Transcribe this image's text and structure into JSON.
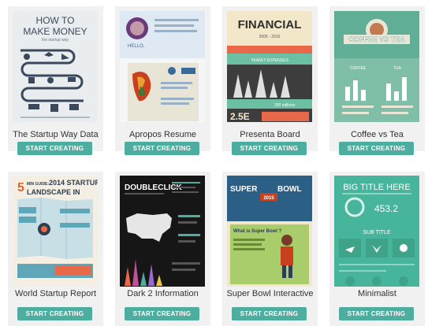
{
  "templates": [
    {
      "title": "The Startup Way Data",
      "button": "START CREATING",
      "thumb_text": [
        "HOW TO",
        "MAKE MONEY",
        "the startup way"
      ]
    },
    {
      "title": "Apropos Resume",
      "button": "START CREATING",
      "thumb_text": [
        "HELLO,"
      ]
    },
    {
      "title": "Presenta Board",
      "button": "START CREATING",
      "thumb_text": [
        "FINANCIAL",
        "2005 - 2015",
        "YEARLY EXPENSES",
        "200 millions",
        "2.5E"
      ]
    },
    {
      "title": "Coffee vs Tea",
      "button": "START CREATING",
      "thumb_text": [
        "COFFEE VS TEA",
        "COFFEE",
        "TEA"
      ]
    },
    {
      "title": "World Startup Report",
      "button": "START CREATING",
      "thumb_text": [
        "5",
        "MIN GUIDE:",
        "2014 STARTUP",
        "LANDSCAPE IN"
      ]
    },
    {
      "title": "Dark 2 Information",
      "button": "START CREATING",
      "thumb_text": [
        "DOUBLECLICK"
      ]
    },
    {
      "title": "Super Bowl Interactive",
      "button": "START CREATING",
      "thumb_text": [
        "SUPER",
        "BOWL",
        "2015",
        "What is Super Bowl ?"
      ]
    },
    {
      "title": "Minimalist",
      "button": "START CREATING",
      "thumb_text": [
        "BIG TITLE HERE",
        "453.2",
        "SUB TITLE"
      ]
    }
  ],
  "colors": {
    "button": "#4dae9f",
    "card_bg": "#f1f1f1"
  }
}
